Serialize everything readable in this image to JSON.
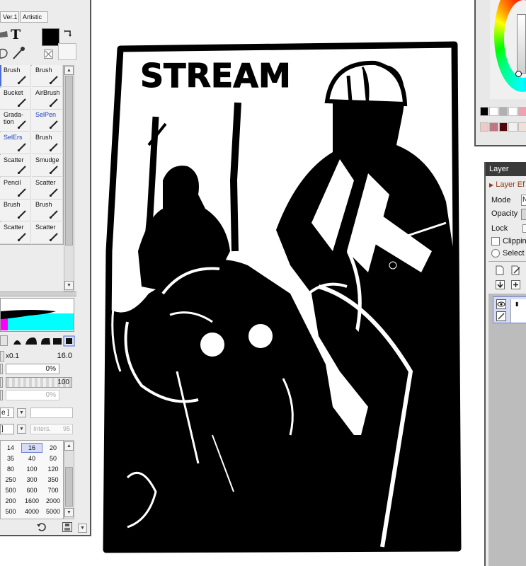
{
  "tool_panel": {
    "tabs": [
      "Ver.1",
      "Artistic"
    ],
    "tools": [
      [
        {
          "label": "Brush",
          "blue": false
        },
        {
          "label": "Brush",
          "blue": false
        }
      ],
      [
        {
          "label": "Bucket",
          "blue": false
        },
        {
          "label": "AirBrush",
          "blue": false
        }
      ],
      [
        {
          "label": "Grada-\ntion",
          "blue": false
        },
        {
          "label": "SelPen",
          "blue": true
        }
      ],
      [
        {
          "label": "SelErs",
          "blue": true
        },
        {
          "label": "Brush",
          "blue": false
        }
      ],
      [
        {
          "label": "Scatter",
          "blue": false
        },
        {
          "label": "Smudge",
          "blue": false
        }
      ],
      [
        {
          "label": "Pencil",
          "blue": false
        },
        {
          "label": "Scatter",
          "blue": false
        }
      ],
      [
        {
          "label": "Brush",
          "blue": false
        },
        {
          "label": "Brush",
          "blue": false
        }
      ],
      [
        {
          "label": "Scatter",
          "blue": false
        },
        {
          "label": "Scatter",
          "blue": false
        }
      ]
    ],
    "size_multiplier": "x0.1",
    "size_value": "16.0",
    "density_percent": "0%",
    "max_density": "100",
    "min_size_percent": "0%",
    "dropdown1_text": "e ]",
    "dropdown2_text": "]",
    "inters_label": "Inters.",
    "inters_value": "95",
    "brush_sizes": [
      [
        "14",
        "16",
        "20"
      ],
      [
        "35",
        "40",
        "50"
      ],
      [
        "80",
        "100",
        "120"
      ],
      [
        "250",
        "300",
        "350"
      ],
      [
        "500",
        "600",
        "700"
      ],
      [
        "200",
        "1600",
        "2000"
      ],
      [
        "500",
        "4000",
        "5000"
      ]
    ],
    "selected_size": "16"
  },
  "canvas": {
    "title_text": "STREAM"
  },
  "color_panel": {
    "swatches_row1": [
      "#000000",
      "#ffffff",
      "#b0b0b0",
      "#ffffff",
      "#f0a0b0"
    ],
    "swatches_row2": [
      "#f0c8c8",
      "#c07880",
      "#500808",
      "#f0f0f0",
      "#f0e0d8"
    ]
  },
  "layer_panel": {
    "title": "Layer",
    "layer_effect": "Layer Ef",
    "mode_label": "Mode",
    "opacity_label": "Opacity",
    "lock_label": "Lock",
    "clipping_label": "Clippin",
    "select_label": "Select"
  },
  "colors": {
    "panel_bg": "#ececec",
    "title_bar": "#3a3a3a",
    "accent_blue": "#1a3fbf",
    "cyan": "#00ffff",
    "magenta": "#ff00ff"
  }
}
